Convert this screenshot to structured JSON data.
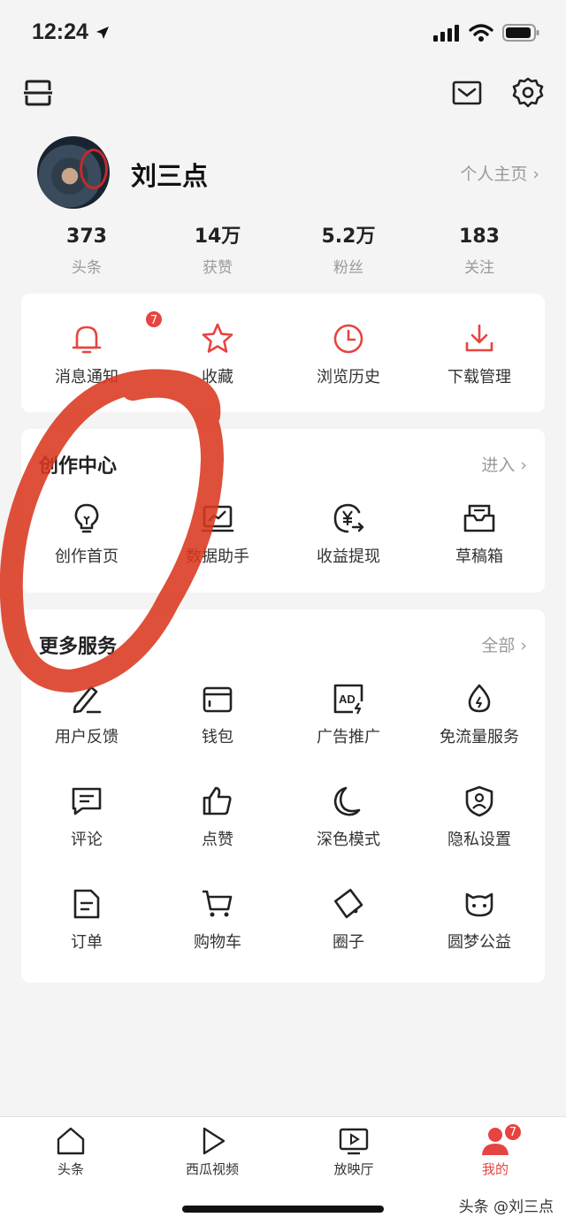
{
  "status_bar": {
    "time": "12:24"
  },
  "profile": {
    "username": "刘三点",
    "homepage_link": "个人主页 ›"
  },
  "stats": [
    {
      "value": "373",
      "label": "头条"
    },
    {
      "value": "14万",
      "label": "获赞"
    },
    {
      "value": "5.2万",
      "label": "粉丝"
    },
    {
      "value": "183",
      "label": "关注"
    }
  ],
  "quick_actions": [
    {
      "label": "消息通知",
      "icon": "bell-icon",
      "badge": "7"
    },
    {
      "label": "收藏",
      "icon": "star-icon"
    },
    {
      "label": "浏览历史",
      "icon": "clock-icon"
    },
    {
      "label": "下载管理",
      "icon": "download-icon"
    }
  ],
  "creation_center": {
    "title": "创作中心",
    "more_link": "进入 ›",
    "items": [
      {
        "label": "创作首页",
        "icon": "lightbulb-icon"
      },
      {
        "label": "数据助手",
        "icon": "chart-icon"
      },
      {
        "label": "收益提现",
        "icon": "yuan-withdraw-icon"
      },
      {
        "label": "草稿箱",
        "icon": "draft-box-icon"
      }
    ]
  },
  "more_services": {
    "title": "更多服务",
    "more_link": "全部 ›",
    "items": [
      {
        "label": "用户反馈",
        "icon": "pen-icon"
      },
      {
        "label": "钱包",
        "icon": "wallet-icon"
      },
      {
        "label": "广告推广",
        "icon": "ad-icon"
      },
      {
        "label": "免流量服务",
        "icon": "data-drop-icon"
      },
      {
        "label": "评论",
        "icon": "comment-icon"
      },
      {
        "label": "点赞",
        "icon": "thumbs-up-icon"
      },
      {
        "label": "深色模式",
        "icon": "moon-icon"
      },
      {
        "label": "隐私设置",
        "icon": "shield-icon"
      },
      {
        "label": "订单",
        "icon": "document-icon"
      },
      {
        "label": "购物车",
        "icon": "cart-icon"
      },
      {
        "label": "圈子",
        "icon": "circle-group-icon"
      },
      {
        "label": "圆梦公益",
        "icon": "cat-face-icon"
      }
    ]
  },
  "tabbar": {
    "items": [
      {
        "label": "头条",
        "icon": "house-icon"
      },
      {
        "label": "西瓜视频",
        "icon": "play-icon"
      },
      {
        "label": "放映厅",
        "icon": "tv-icon"
      },
      {
        "label": "我的",
        "icon": "person-icon",
        "badge": "7",
        "active": true
      }
    ]
  },
  "watermark": "头条 @刘三点",
  "colors": {
    "accent": "#e64440",
    "annotation": "#d9381e",
    "background": "#f4f4f4"
  }
}
